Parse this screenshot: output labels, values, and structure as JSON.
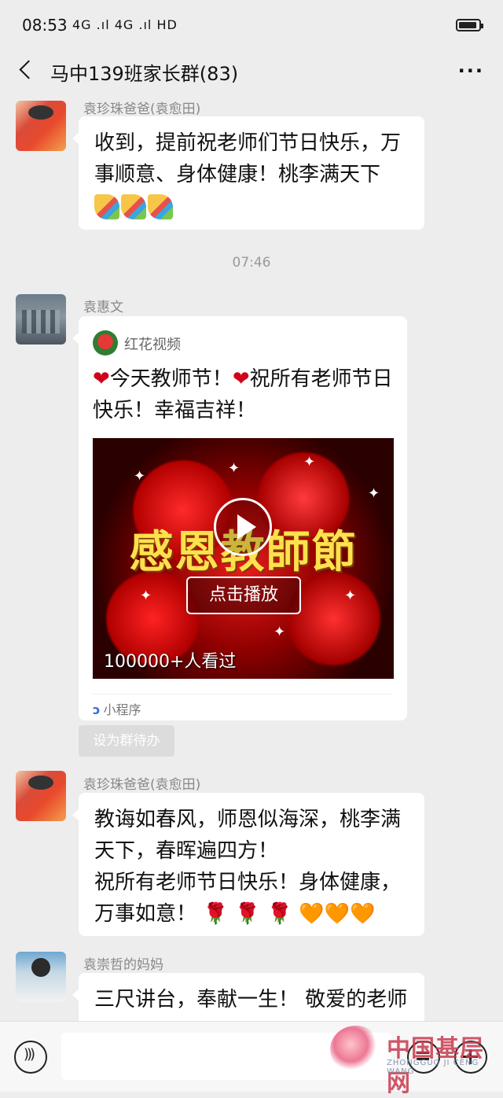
{
  "status": {
    "time": "08:53",
    "signal": "4G .ıl 4G .ıl HD",
    "battery_icon": "battery-icon"
  },
  "header": {
    "title": "马中139班家长群(83)",
    "more": "···"
  },
  "messages": [
    {
      "sender": "袁珍珠爸爸(袁愈田)",
      "text": "收到，提前祝老师们节日快乐，万事顺意、身体健康！桃李满天下"
    },
    {
      "timestamp": "07:46"
    },
    {
      "sender": "袁惠文",
      "card": {
        "source": "红花视频",
        "text_a": "今天教师节！",
        "text_b": "祝所有老师节日快乐！幸福吉祥！",
        "thumb_title": "感恩教師節",
        "play_label": "点击播放",
        "views": "100000+人看过",
        "footer": "小程序"
      },
      "action": "设为群待办"
    },
    {
      "sender": "袁珍珠爸爸(袁愈田)",
      "text": "教诲如春风，师恩似海深，桃李满天下，春晖遍四方！",
      "text2": "祝所有老师节日快乐！身体健康，万事如意！",
      "emoji": "🌹 🌹 🌹 🧡🧡🧡"
    },
    {
      "sender": "袁崇哲的妈妈",
      "text": "三尺讲台，奉献一生！ 敬爱的老师"
    }
  ],
  "input": {
    "placeholder": ""
  },
  "watermark": {
    "name": "中国基层网",
    "sub": "ZHONGGUO JI CENG WANG"
  },
  "colors": {
    "background": "#ededed",
    "bubble": "#ffffff",
    "heart": "#d0021b"
  }
}
